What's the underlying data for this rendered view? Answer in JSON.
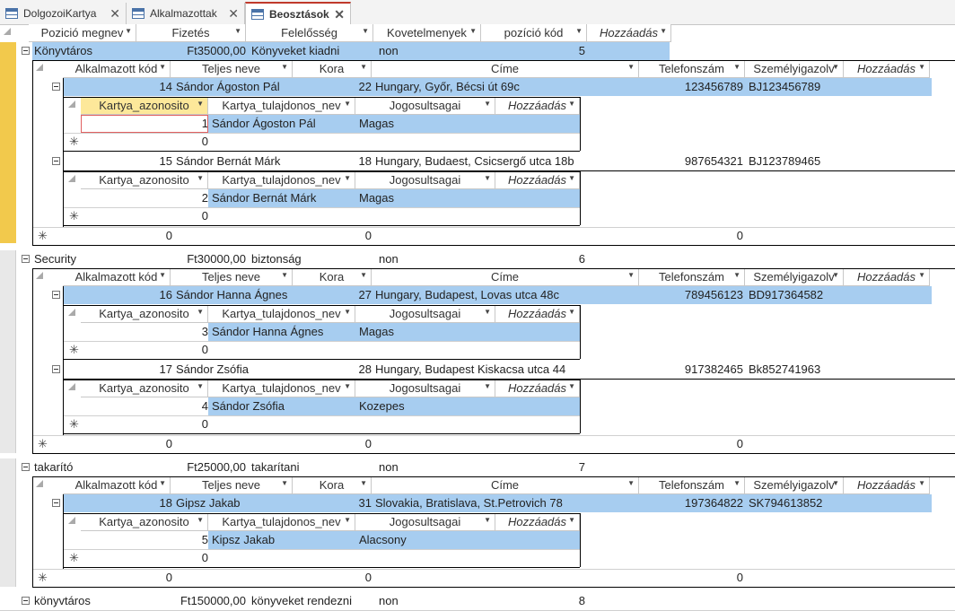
{
  "tabs": [
    {
      "label": "DolgozoiKartya"
    },
    {
      "label": "Alkalmazottak"
    },
    {
      "label": "Beosztások"
    }
  ],
  "close_glyph": "✕",
  "main_headers": [
    "Pozició megnev",
    "Fizetés",
    "Felelősség",
    "Kovetelmenyek",
    "pozíció kód",
    "Hozzáadás"
  ],
  "emp_headers": [
    "Alkalmazott kód",
    "Teljes neve",
    "Kora",
    "Címe",
    "Telefonszám",
    "Személyigazolv",
    "Hozzáadás"
  ],
  "card_headers": [
    "Kartya_azonosito",
    "Kartya_tulajdonos_nev",
    "Jogosultsagai",
    "Hozzáadás"
  ],
  "new_row_glyph": "✳",
  "zero": "0",
  "groups": [
    {
      "position": {
        "name": "Könyvtáros",
        "salary": "Ft35000,00",
        "responsibility": "Könyveket kiadni",
        "requirements": "non",
        "code": "5"
      },
      "employees": [
        {
          "id": "14",
          "name": "Sándor Ágoston Pál",
          "age": "22",
          "address": "Hungary, Győr, Bécsi út 69c",
          "phone": "123456789",
          "idcard": "BJ123456789",
          "card": {
            "id": "1",
            "owner": "Sándor Ágoston Pál",
            "rights": "Magas"
          }
        },
        {
          "id": "15",
          "name": "Sándor Bernát Márk",
          "age": "18",
          "address": "Hungary, Budaest, Csicsergő utca 18b",
          "phone": "987654321",
          "idcard": "BJ123789465",
          "card": {
            "id": "2",
            "owner": "Sándor Bernát Márk",
            "rights": "Magas"
          }
        }
      ]
    },
    {
      "position": {
        "name": "Security",
        "salary": "Ft30000,00",
        "responsibility": "biztonság",
        "requirements": "non",
        "code": "6"
      },
      "employees": [
        {
          "id": "16",
          "name": "Sándor Hanna Ágnes",
          "age": "27",
          "address": "Hungary, Budapest, Lovas utca 48c",
          "phone": "789456123",
          "idcard": "BD917364582",
          "card": {
            "id": "3",
            "owner": "Sándor Hanna Ágnes",
            "rights": "Magas"
          }
        },
        {
          "id": "17",
          "name": "Sándor Zsófia",
          "age": "28",
          "address": "Hungary, Budapest Kiskacsa utca 44",
          "phone": "917382465",
          "idcard": "Bk852741963",
          "card": {
            "id": "4",
            "owner": "Sándor Zsófia",
            "rights": "Kozepes"
          }
        }
      ]
    },
    {
      "position": {
        "name": "takarító",
        "salary": "Ft25000,00",
        "responsibility": "takarítani",
        "requirements": "non",
        "code": "7"
      },
      "employees": [
        {
          "id": "18",
          "name": "Gipsz Jakab",
          "age": "31",
          "address": "Slovakia, Bratislava, St.Petrovich 78",
          "phone": "197364822",
          "idcard": "SK794613852",
          "card": {
            "id": "5",
            "owner": "Kipsz Jakab",
            "rights": "Alacsony"
          }
        }
      ]
    },
    {
      "position": {
        "name": "könyvtáros",
        "salary": "Ft150000,00",
        "responsibility": "könyveket rendezni",
        "requirements": "non",
        "code": "8"
      },
      "employees": []
    }
  ],
  "colors": {
    "highlight": "#a7cdf0",
    "selected_row": "#f2c94c",
    "active_tab_accent": "#c0392b"
  }
}
